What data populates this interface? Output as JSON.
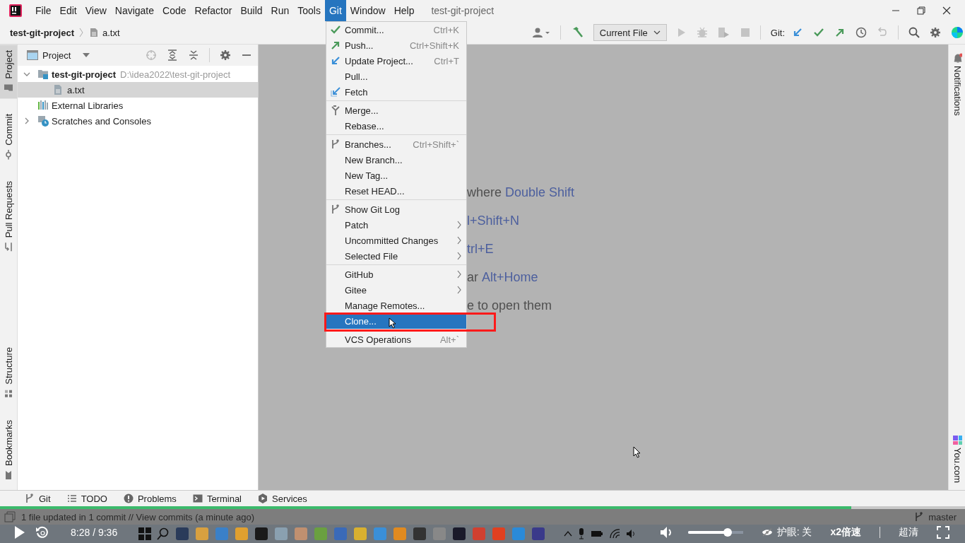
{
  "window": {
    "title": "test-git-project"
  },
  "menu_bar": [
    {
      "label": "File",
      "selected": false
    },
    {
      "label": "Edit",
      "selected": false
    },
    {
      "label": "View",
      "selected": false
    },
    {
      "label": "Navigate",
      "selected": false
    },
    {
      "label": "Code",
      "selected": false
    },
    {
      "label": "Refactor",
      "selected": false
    },
    {
      "label": "Build",
      "selected": false
    },
    {
      "label": "Run",
      "selected": false
    },
    {
      "label": "Tools",
      "selected": false
    },
    {
      "label": "Git",
      "selected": true
    },
    {
      "label": "Window",
      "selected": false
    },
    {
      "label": "Help",
      "selected": false
    }
  ],
  "breadcrumb": [
    {
      "label": "test-git-project",
      "kind": "project"
    },
    {
      "label": "a.txt",
      "kind": "file"
    }
  ],
  "toolbar": {
    "run_config": "Current File",
    "git_label": "Git:"
  },
  "left_stripe_top": [
    {
      "label": "Project",
      "kind": "folder",
      "selected": true
    },
    {
      "label": "Commit",
      "kind": "commit",
      "selected": false
    },
    {
      "label": "Pull Requests",
      "kind": "pull",
      "selected": false
    }
  ],
  "left_stripe_bottom": [
    {
      "label": "Structure",
      "kind": "structure",
      "selected": false
    },
    {
      "label": "Bookmarks",
      "kind": "bookmark",
      "selected": false
    }
  ],
  "project_panel": {
    "title": "Project",
    "tree": [
      {
        "label": "test-git-project",
        "path": "D:\\idea2022\\test-git-project",
        "kind": "module",
        "expanded": true,
        "selected": false,
        "children": [
          {
            "label": "a.txt",
            "kind": "file",
            "selected": true
          }
        ]
      },
      {
        "label": "External Libraries",
        "kind": "library",
        "selected": false
      },
      {
        "label": "Scratches and Consoles",
        "kind": "scratches",
        "expanded": false,
        "selected": false
      }
    ]
  },
  "editor_hints": [
    [
      {
        "kind": "text",
        "text": "where"
      },
      {
        "kind": "shortcut",
        "text": "Double Shift"
      }
    ],
    [
      {
        "kind": "shortcut",
        "text": "l+Shift+N"
      }
    ],
    [
      {
        "kind": "shortcut",
        "text": "trl+E"
      }
    ],
    [
      {
        "kind": "text",
        "text": "ar"
      },
      {
        "kind": "shortcut",
        "text": "Alt+Home"
      }
    ],
    [
      {
        "kind": "text",
        "text": "e to open them"
      }
    ]
  ],
  "git_menu": [
    [
      {
        "label": "Commit...",
        "shortcut": "Ctrl+K",
        "kind": "check",
        "submenu": false,
        "selected": false
      },
      {
        "label": "Push...",
        "shortcut": "Ctrl+Shift+K",
        "kind": "push",
        "submenu": false,
        "selected": false
      },
      {
        "label": "Update Project...",
        "shortcut": "Ctrl+T",
        "kind": "update",
        "submenu": false,
        "selected": false
      },
      {
        "label": "Pull...",
        "submenu": false,
        "selected": false
      },
      {
        "label": "Fetch",
        "kind": "fetch",
        "submenu": false,
        "selected": false
      }
    ],
    [
      {
        "label": "Merge...",
        "kind": "merge",
        "submenu": false,
        "selected": false
      },
      {
        "label": "Rebase...",
        "submenu": false,
        "selected": false
      }
    ],
    [
      {
        "label": "Branches...",
        "shortcut": "Ctrl+Shift+`",
        "kind": "branch",
        "submenu": false,
        "selected": false
      },
      {
        "label": "New Branch...",
        "submenu": false,
        "selected": false
      },
      {
        "label": "New Tag...",
        "submenu": false,
        "selected": false
      },
      {
        "label": "Reset HEAD...",
        "submenu": false,
        "selected": false
      }
    ],
    [
      {
        "label": "Show Git Log",
        "kind": "branch",
        "submenu": false,
        "selected": false
      },
      {
        "label": "Patch",
        "submenu": true,
        "selected": false
      },
      {
        "label": "Uncommitted Changes",
        "submenu": true,
        "selected": false
      },
      {
        "label": "Selected File",
        "submenu": true,
        "selected": false
      }
    ],
    [
      {
        "label": "GitHub",
        "submenu": true,
        "selected": false
      },
      {
        "label": "Gitee",
        "submenu": true,
        "selected": false
      },
      {
        "label": "Manage Remotes...",
        "submenu": false,
        "selected": false
      },
      {
        "label": "Clone...",
        "submenu": false,
        "selected": true
      }
    ],
    [
      {
        "label": "VCS Operations",
        "shortcut": "Alt+`",
        "submenu": false,
        "selected": false
      }
    ]
  ],
  "right_stripe": [
    {
      "label": "Notifications",
      "kind": "bell"
    },
    {
      "label": "You.com",
      "kind": "you"
    }
  ],
  "bottom_tabs": [
    {
      "label": "Git",
      "kind": "branch"
    },
    {
      "label": "TODO",
      "kind": "list"
    },
    {
      "label": "Problems",
      "kind": "problem"
    },
    {
      "label": "Terminal",
      "kind": "terminal"
    },
    {
      "label": "Services",
      "kind": "services"
    }
  ],
  "status_bar": {
    "message": "1 file updated in 1 commit // View commits (a minute ago)",
    "branch": "master"
  },
  "video_player": {
    "time": "8:28 / 9:36",
    "progress": {
      "level": 0.882
    },
    "volume": {
      "level": 0.72
    },
    "eye_care": "护眼: 关",
    "speed": "x2倍速",
    "quality": "超清"
  }
}
